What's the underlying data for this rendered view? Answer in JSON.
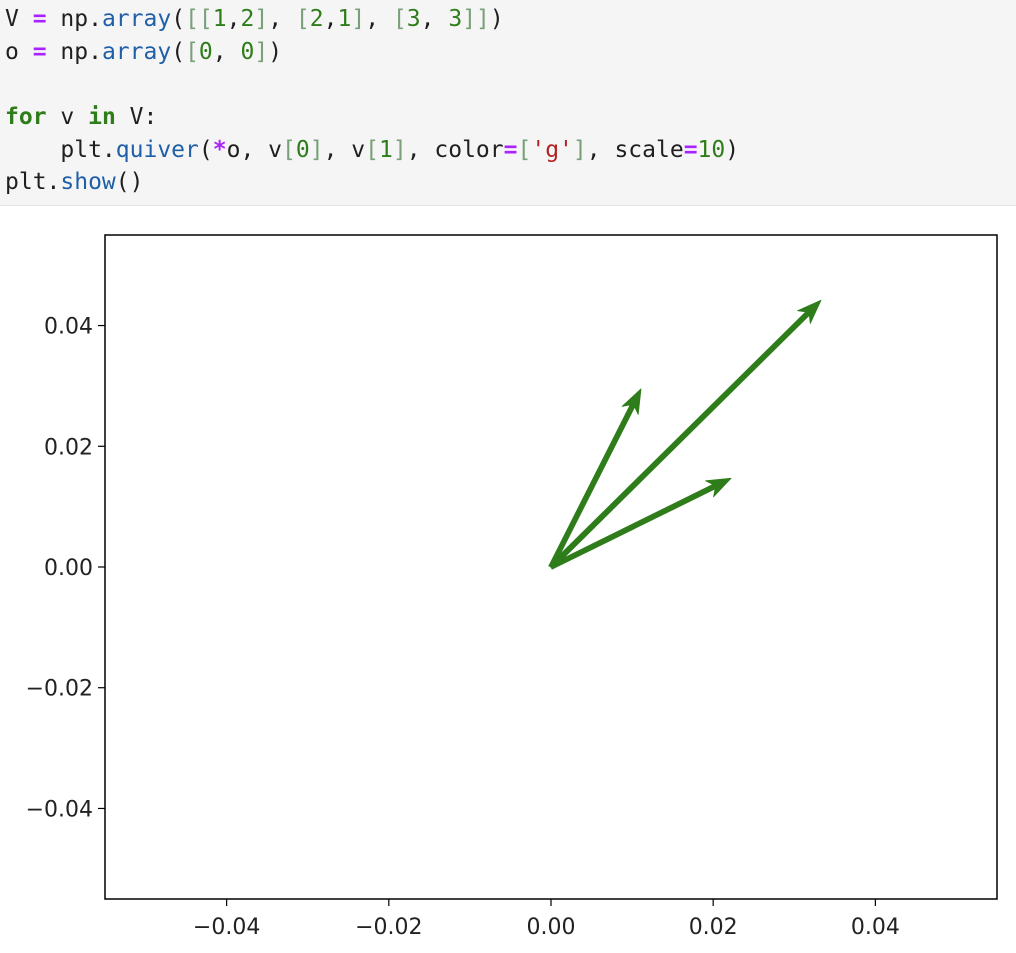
{
  "code": {
    "line1": {
      "a": "V ",
      "op": "=",
      "b": " np.",
      "fn": "array",
      "c": "(",
      "br1": "[[",
      "n1": "1",
      "comma1": ",",
      "n2": "2",
      "br2": "]",
      "sep1": ", ",
      "br3": "[",
      "n3": "2",
      "comma2": ",",
      "n4": "1",
      "br4": "]",
      "sep2": ", ",
      "br5": "[",
      "n5": "3",
      "comma3": ", ",
      "n6": "3",
      "br6": "]]",
      "d": ")"
    },
    "line2": {
      "a": "o ",
      "op": "=",
      "b": " np.",
      "fn": "array",
      "c": "(",
      "br1": "[",
      "n1": "0",
      "comma1": ", ",
      "n2": "0",
      "br2": "]",
      "d": ")"
    },
    "line4": {
      "kw1": "for",
      "a": " v ",
      "kw2": "in",
      "b": " V:"
    },
    "line5": {
      "indent": "    plt.",
      "fn": "quiver",
      "a": "(",
      "op1": "*",
      "b": "o, v",
      "br1": "[",
      "n1": "0",
      "br2": "]",
      "c": ", v",
      "br3": "[",
      "n2": "1",
      "br4": "]",
      "d": ", color",
      "op2": "=",
      "br5": "[",
      "s": "'g'",
      "br6": "]",
      "e": ", scale",
      "op3": "=",
      "n3": "10",
      "f": ")"
    },
    "line6": {
      "a": "plt.",
      "fn": "show",
      "b": "()"
    }
  },
  "chart_data": {
    "type": "quiver",
    "title": "",
    "xlabel": "",
    "ylabel": "",
    "xlim": [
      -0.055,
      0.055
    ],
    "ylim": [
      -0.055,
      0.055
    ],
    "x_ticks": [
      -0.04,
      -0.02,
      0.0,
      0.02,
      0.04
    ],
    "y_ticks": [
      -0.04,
      -0.02,
      0.0,
      0.02,
      0.04
    ],
    "x_tick_labels": [
      "−0.04",
      "−0.02",
      "0.00",
      "0.02",
      "0.04"
    ],
    "y_tick_labels": [
      "−0.04",
      "−0.02",
      "0.00",
      "0.02",
      "0.04"
    ],
    "grid": false,
    "color": "#2e7d1a",
    "origin": [
      0,
      0
    ],
    "vectors": [
      {
        "u": 1,
        "v": 2,
        "tip": [
          0.0111,
          0.0295
        ]
      },
      {
        "u": 2,
        "v": 1,
        "tip": [
          0.0222,
          0.0147
        ]
      },
      {
        "u": 3,
        "v": 3,
        "tip": [
          0.0333,
          0.0442
        ]
      }
    ]
  }
}
